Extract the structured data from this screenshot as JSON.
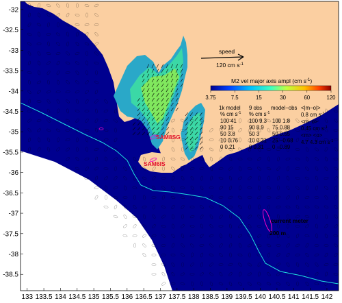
{
  "map": {
    "x_ticks": [
      "133",
      "133.5",
      "134",
      "134.5",
      "135",
      "135.5",
      "136",
      "136.5",
      "137",
      "137.5",
      "138",
      "138.5",
      "139",
      "139.5",
      "140",
      "140.5",
      "141",
      "141.5",
      "142"
    ],
    "y_ticks": [
      "-32",
      "-32.5",
      "-33",
      "-33.5",
      "-34",
      "-34.5",
      "-35",
      "-35.5",
      "-36",
      "-36.5",
      "-37",
      "-37.5",
      "-38",
      "-38.5"
    ],
    "x_range": [
      132.8,
      142.35
    ],
    "y_range": [
      -38.9,
      -31.8
    ]
  },
  "speed_key": {
    "title": "speed",
    "value": "120 cm s",
    "exp": "-1"
  },
  "colorbar": {
    "title_prefix": "M2 vel major axis ampl (cm s",
    "title_exp": "-1",
    "title_suffix": ")",
    "ticks": [
      "3.75",
      "7.5",
      "15",
      "30",
      "60",
      "120"
    ],
    "colors": [
      "#00008f",
      "#0040ff",
      "#00c0ff",
      "#40ffbf",
      "#c0ff40",
      "#ffc000",
      "#ff4000",
      "#8f0000"
    ]
  },
  "stats": {
    "col1_header": "1k model",
    "col2_header": "9 obs",
    "col3_header": "model−obs",
    "sub_headers_1": "%  cm s",
    "sub_headers_2": "%  cm s",
    "sub_exp": "-1",
    "col1_rows": [
      "100 41",
      "90 15",
      "50 3.8",
      "10 0.76",
      "0 0.21"
    ],
    "col2_rows": [
      "100 9.3",
      "90 8.9",
      "50 3",
      "10 0.31",
      "0 0.31"
    ],
    "col3_rows": [
      "100 1.8",
      "75 0.88",
      "50 0.55",
      "25 −0.68",
      "0 −0.89"
    ],
    "mean_abs_label": "<|m−o|>",
    "mean_abs_value": "0.8 cm s",
    "mean_label": "<m−o>",
    "mean_value": "0.45 cm s",
    "means_label": "<m>  <o>",
    "means_value": "4.7 4.3 cm s",
    "exp": "-1"
  },
  "labels": {
    "sam8sg": "SAM8SG",
    "sam6is": "SAM6IS",
    "current_meter": "current meter",
    "isobath": "200 m"
  },
  "colors": {
    "land": "#fbcfa1",
    "ocean": "#00008f",
    "isobath": "#20e0e0",
    "ellipse": "#ff00c8",
    "label_red": "#e0102a"
  }
}
